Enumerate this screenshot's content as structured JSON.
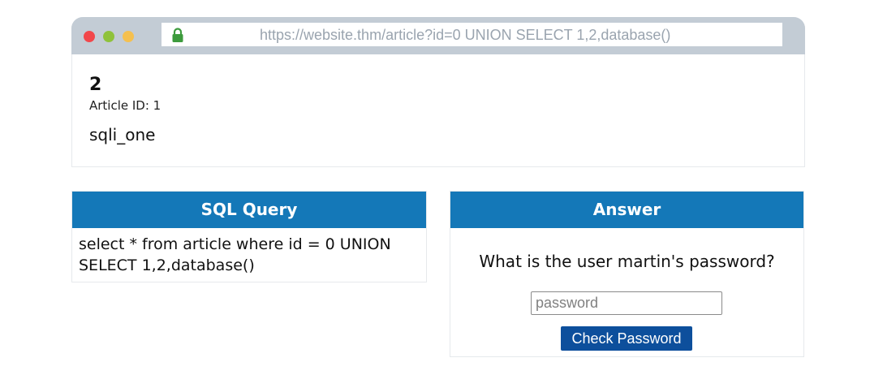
{
  "browser": {
    "url": "https://website.thm/article?id=0 UNION SELECT 1,2,database()",
    "lock_icon": "lock-icon"
  },
  "article": {
    "number": "2",
    "id_label": "Article ID: 1",
    "body": "sqli_one"
  },
  "sql_panel": {
    "title": "SQL Query",
    "query": "select * from article where id = 0 UNION SELECT 1,2,database()"
  },
  "answer_panel": {
    "title": "Answer",
    "question": "What is the user martin's password?",
    "input_value": "",
    "input_placeholder": "password",
    "button_label": "Check Password"
  },
  "colors": {
    "header_blue": "#1478b8",
    "button_blue": "#0d4f9c",
    "browser_bar": "#c3ccd5"
  }
}
